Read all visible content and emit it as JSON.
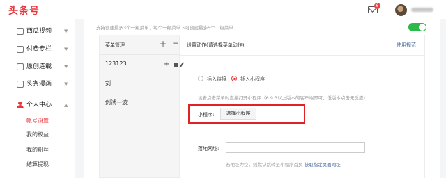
{
  "header": {
    "logo": "头条号",
    "mail_badge": "6"
  },
  "sidebar": {
    "items": [
      {
        "label": "西瓜视频"
      },
      {
        "label": "付费专栏"
      },
      {
        "label": "原创连载"
      },
      {
        "label": "头条漫画"
      },
      {
        "label": "个人中心"
      }
    ],
    "subitems": [
      {
        "label": "帐号设置",
        "active": true
      },
      {
        "label": "我的权益"
      },
      {
        "label": "我的粉丝"
      },
      {
        "label": "结算提现"
      }
    ]
  },
  "main": {
    "hint": "支持创建最多3个一级菜单，每个一级菜单下可创建最多5个二级菜单",
    "toggle_on": true,
    "menu_panel": {
      "title": "菜单管理",
      "rows": [
        "123123",
        "剑",
        "剑试一波"
      ]
    },
    "settings": {
      "title": "设置动作(请选择菜单动作)",
      "spec_link": "使用规范",
      "radio_link": "插入链接",
      "radio_mini": "插入小程序",
      "description": "读者点击菜单时直接打开小程序（6.9.3以上版本的客户端即可，低版本点击无反应）",
      "mini_label": "小程序:",
      "mini_button": "选择小程序",
      "addr_label": "落地网址:",
      "addr_value": "",
      "addr_hint": "若地址为空，则默认跳转至小程序首页",
      "addr_link": "获取指定页面网址"
    }
  },
  "colors": {
    "brand": "#e8363a",
    "toggle": "#2fb84a",
    "link": "#406599",
    "highlight": "#e22222"
  }
}
